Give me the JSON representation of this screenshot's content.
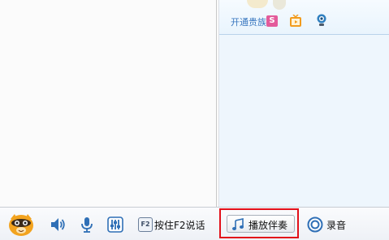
{
  "top_panel": {
    "vip_link": "开通贵族",
    "vip_badge": "S"
  },
  "toolbar": {
    "avatar_icon": "yy-mascot-icon",
    "volume_icon": "speaker-icon",
    "mic_icon": "microphone-icon",
    "mixer_icon": "equalizer-icon",
    "f2_key": "F2",
    "push_to_talk_label": "按住F2说话",
    "accompaniment_label": "播放伴奏",
    "record_label": "录音"
  },
  "colors": {
    "highlight": "#e2101a",
    "link": "#3a78c0"
  }
}
